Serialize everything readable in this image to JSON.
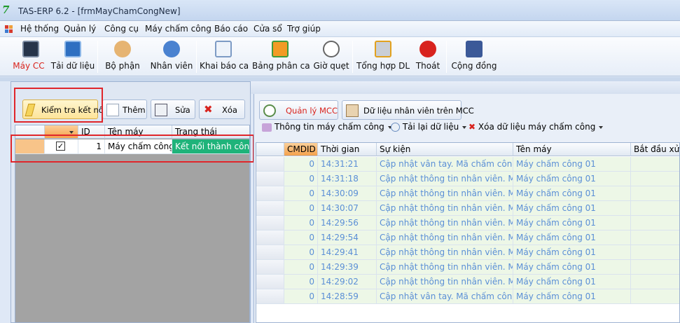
{
  "window": {
    "title": "TAS-ERP 6.2 - [frmMayChamCongNew]",
    "logo_text": "7"
  },
  "menu": [
    "Hệ thống",
    "Quản lý",
    "Công cụ",
    "Máy chấm công",
    "Báo cáo",
    "Cửa sổ",
    "Trợ giúp"
  ],
  "toolbar": [
    {
      "label": "Máy CC",
      "icon": "monitor-icon",
      "active": true
    },
    {
      "label": "Tải dữ liệu",
      "icon": "download-icon"
    },
    {
      "label": "Bộ phận",
      "icon": "group-icon"
    },
    {
      "label": "Nhân viên",
      "icon": "user-icon"
    },
    {
      "label": "Khai báo ca",
      "icon": "calendar-icon"
    },
    {
      "label": "Bảng phân ca",
      "icon": "swap-arrows-icon"
    },
    {
      "label": "Giờ quẹt",
      "icon": "clock-icon"
    },
    {
      "label": "Tổng hợp DL",
      "icon": "printer-icon"
    },
    {
      "label": "Thoát",
      "icon": "close-icon"
    },
    {
      "label": "Cộng đồng",
      "icon": "facebook-icon"
    }
  ],
  "left": {
    "buttons": {
      "check": "Kiểm tra kết nối",
      "add": "Thêm",
      "edit": "Sửa",
      "delete": "Xóa"
    },
    "grid": {
      "headers": [
        "",
        "ID",
        "Tên máy",
        "Trạng thái"
      ],
      "rows": [
        {
          "checked": true,
          "id": "1",
          "name": "Máy chấm công",
          "status": "Kết nối thành công"
        }
      ]
    }
  },
  "right": {
    "tabs": {
      "manage": "Quản lý MCC",
      "employees": "Dữ liệu nhân viên trên MCC"
    },
    "subtoolbar": {
      "info": "Thông tin máy chấm công",
      "reload": "Tải lại dữ liệu",
      "delete": "Xóa dữ liệu máy chấm công"
    },
    "grid": {
      "headers": [
        "CMDID",
        "Thời gian",
        "Sự kiện",
        "Tên máy",
        "Bắt đầu xử"
      ],
      "rows": [
        {
          "cmdid": "0",
          "time": "14:31:21",
          "event": "Cập nhật vân tay. Mã chấm công:",
          "machine": "Máy chấm công 01"
        },
        {
          "cmdid": "0",
          "time": "14:31:18",
          "event": "Cập nhật thông tin nhân viên. Mã",
          "machine": "Máy chấm công 01"
        },
        {
          "cmdid": "0",
          "time": "14:30:09",
          "event": "Cập nhật thông tin nhân viên. Mã",
          "machine": "Máy chấm công 01"
        },
        {
          "cmdid": "0",
          "time": "14:30:07",
          "event": "Cập nhật thông tin nhân viên. Mã",
          "machine": "Máy chấm công 01"
        },
        {
          "cmdid": "0",
          "time": "14:29:56",
          "event": "Cập nhật thông tin nhân viên. Mã",
          "machine": "Máy chấm công 01"
        },
        {
          "cmdid": "0",
          "time": "14:29:54",
          "event": "Cập nhật thông tin nhân viên. Mã",
          "machine": "Máy chấm công 01"
        },
        {
          "cmdid": "0",
          "time": "14:29:41",
          "event": "Cập nhật thông tin nhân viên. Mã",
          "machine": "Máy chấm công 01"
        },
        {
          "cmdid": "0",
          "time": "14:29:39",
          "event": "Cập nhật thông tin nhân viên. Mã",
          "machine": "Máy chấm công 01"
        },
        {
          "cmdid": "0",
          "time": "14:29:02",
          "event": "Cập nhật thông tin nhân viên. Mã",
          "machine": "Máy chấm công 01"
        },
        {
          "cmdid": "0",
          "time": "14:28:59",
          "event": "Cập nhật vân tay. Mã chấm công:",
          "machine": "Máy chấm công 01"
        }
      ]
    }
  },
  "colors": {
    "row_text": "#5b8fd6",
    "row_bg": "#edf7e7",
    "status_bg": "#1fb37a",
    "header_orange": "#f7b56a",
    "highlight_red": "#e0262b"
  }
}
